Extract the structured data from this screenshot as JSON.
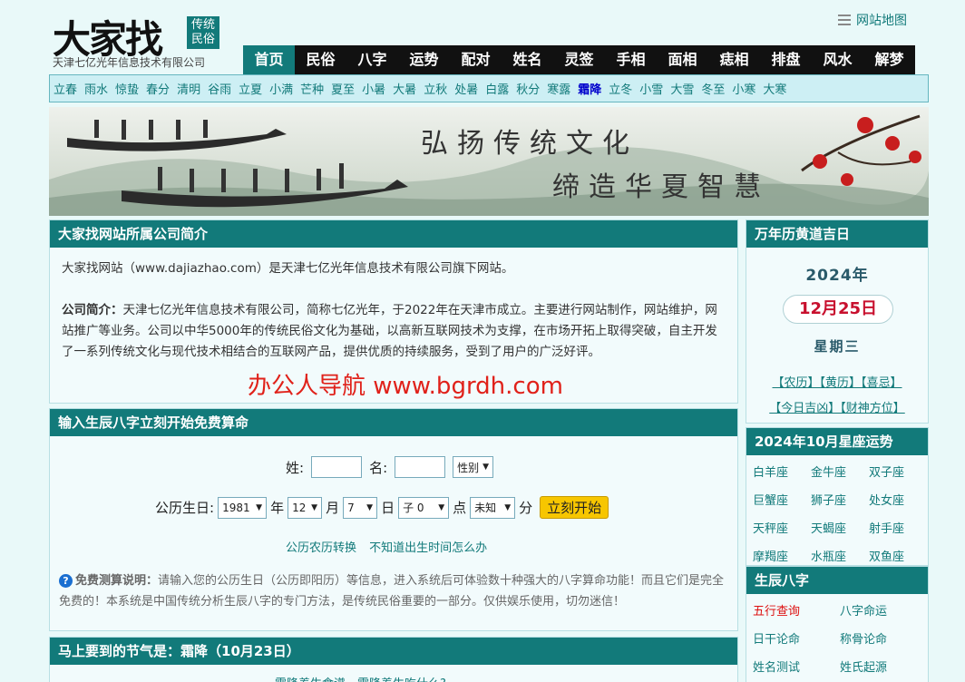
{
  "header": {
    "logo_text": "大家找",
    "logo_badge_line1": "传统",
    "logo_badge_line2": "民俗",
    "company": "天津七亿光年信息技术有限公司",
    "sitemap": "网站地图"
  },
  "mainnav": [
    "首页",
    "民俗",
    "八字",
    "运势",
    "配对",
    "姓名",
    "灵签",
    "手相",
    "面相",
    "痣相",
    "排盘",
    "风水",
    "解梦"
  ],
  "solar_terms": [
    "立春",
    "雨水",
    "惊蛰",
    "春分",
    "清明",
    "谷雨",
    "立夏",
    "小满",
    "芒种",
    "夏至",
    "小暑",
    "大暑",
    "立秋",
    "处暑",
    "白露",
    "秋分",
    "寒露",
    "霜降",
    "立冬",
    "小雪",
    "大雪",
    "冬至",
    "小寒",
    "大寒"
  ],
  "current_term": "霜降",
  "banner": {
    "line1": "弘扬传统文化",
    "line2": "缔造华夏智慧"
  },
  "intro": {
    "title": "大家找网站所属公司简介",
    "p1": "大家找网站（www.dajiazhao.com）是天津七亿光年信息技术有限公司旗下网站。",
    "p2_label": "公司简介：",
    "p2": "天津七亿光年信息技术有限公司，简称七亿光年，于2022年在天津市成立。主要进行网站制作，网站维护，网站推广等业务。公司以中华5000年的传统民俗文化为基础，以高新互联网技术为支撑，在市场开拓上取得突破，自主开发了一系列传统文化与现代技术相结合的互联网产品，提供优质的持续服务，受到了用户的广泛好评。",
    "watermark": "办公人导航 www.bgrdh.com"
  },
  "calc": {
    "title": "输入生辰八字立刻开始免费算命",
    "surname_label": "姓:",
    "name_label": "名:",
    "gender": "性别",
    "birth_label": "公历生日:",
    "year": "1981",
    "year_unit": "年",
    "month": "12",
    "month_unit": "月",
    "day": "7",
    "day_unit": "日",
    "hour": "子 0",
    "hour_unit": "点",
    "minute": "未知",
    "minute_unit": "分",
    "start": "立刻开始",
    "link1": "公历农历转换",
    "link2": "不知道出生时间怎么办",
    "note_label": "免费测算说明：",
    "note": "请输入您的公历生日（公历即阳历）等信息，进入系统后可体验数十种强大的八字算命功能！而且它们是完全免费的！本系统是中国传统分析生辰八字的专门方法，是传统民俗重要的一部分。仅供娱乐使用，切勿迷信！"
  },
  "solar": {
    "title": "马上要到的节气是：霜降（10月23日）",
    "item": "霜降养生食谱，霜降养生吃什么?"
  },
  "calendar": {
    "title": "万年历黄道吉日",
    "year": "2024年",
    "date": "12月25日",
    "weekday": "星期三",
    "links_row1": "【农历】【黄历】【喜忌】",
    "links_row2": "【今日吉凶】【财神方位】"
  },
  "zodiac": {
    "title": "2024年10月星座运势",
    "signs": [
      "白羊座",
      "金牛座",
      "双子座",
      "巨蟹座",
      "狮子座",
      "处女座",
      "天秤座",
      "天蝎座",
      "射手座",
      "摩羯座",
      "水瓶座",
      "双鱼座"
    ]
  },
  "bazi": {
    "title": "生辰八字",
    "items": [
      "五行查询",
      "八字命运",
      "日干论命",
      "称骨论命",
      "姓名测试",
      "姓氏起源"
    ]
  },
  "colors": {
    "teal": "#127a7a",
    "nav_black": "#111111",
    "button_yellow": "#f7c600",
    "red_text": "#c8102e"
  }
}
